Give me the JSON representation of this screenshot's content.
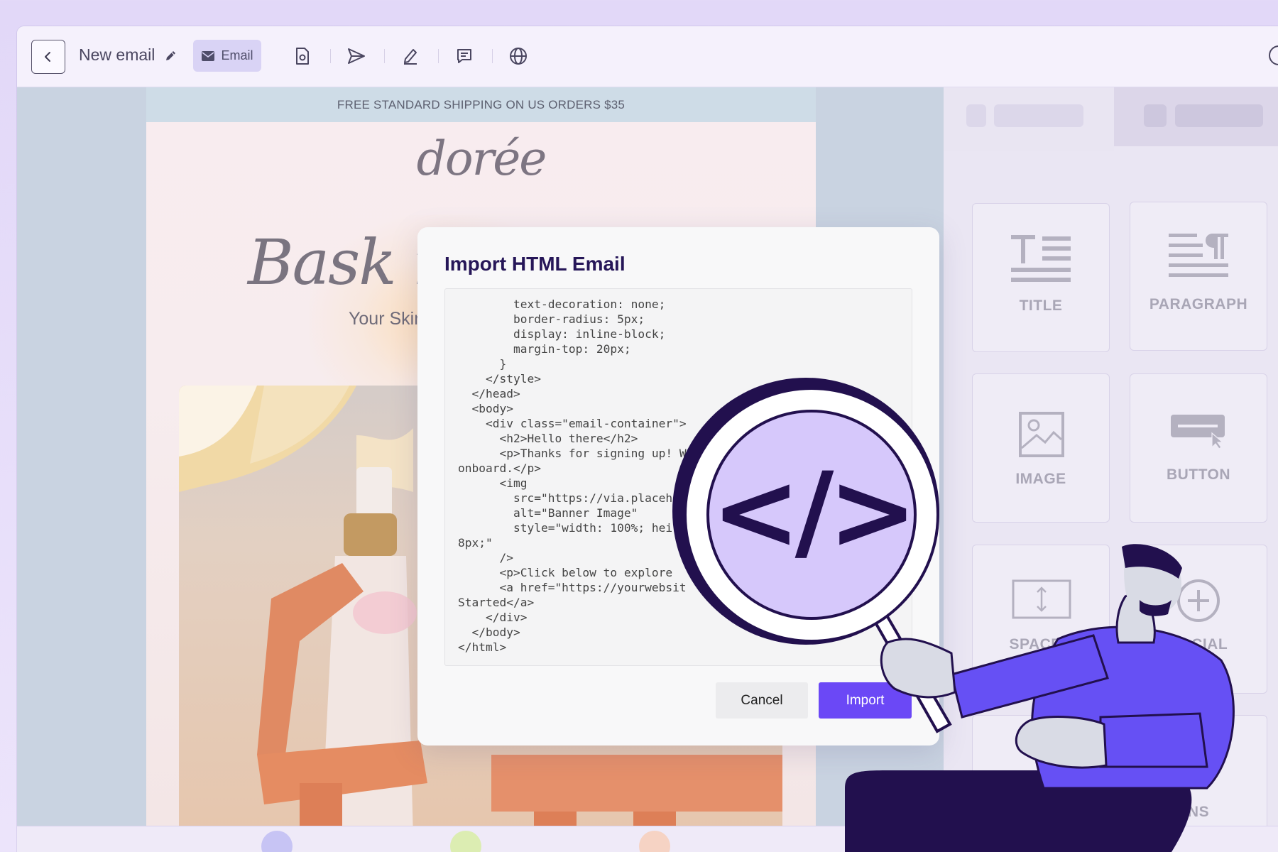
{
  "toolbar": {
    "title": "New email",
    "email_chip_label": "Email",
    "icons": [
      "back-icon",
      "pencil-icon",
      "email-icon",
      "document-icon",
      "send-icon",
      "pen-icon",
      "comment-icon",
      "globe-icon",
      "help-icon"
    ]
  },
  "email_preview": {
    "banner_text": "FREE STANDARD SHIPPING ON US ORDERS $35",
    "brand": "dorée",
    "headline": "Bask i",
    "subheadline": "Your Skin"
  },
  "sidebar": {
    "blocks": [
      {
        "label": "TITLE",
        "icon": "title-icon"
      },
      {
        "label": "PARAGRAPH",
        "icon": "paragraph-icon"
      },
      {
        "label": "IMAGE",
        "icon": "image-icon"
      },
      {
        "label": "BUTTON",
        "icon": "button-icon"
      },
      {
        "label": "SPACER",
        "icon": "spacer-icon"
      },
      {
        "label": "SOCIAL",
        "icon": "social-icon"
      },
      {
        "label": "NS",
        "icon": ""
      }
    ]
  },
  "dialog": {
    "title": "Import HTML Email",
    "code_lines": [
      "        text-decoration: none;",
      "        border-radius: 5px;",
      "        display: inline-block;",
      "        margin-top: 20px;",
      "      }",
      "    </style>",
      "  </head>",
      "  <body>",
      "    <div class=\"email-container\">",
      "      <h2>Hello there</h2>",
      "      <p>Thanks for signing up! We",
      "onboard.</p>",
      "      <img",
      "        src=\"https://via.placeh",
      "        alt=\"Banner Image\"",
      "        style=\"width: 100%; hei",
      "8px;\"",
      "      />",
      "      <p>Click below to explore",
      "      <a href=\"https://yourwebsit",
      "Started</a>",
      "    </div>",
      "  </body>",
      "</html>"
    ],
    "cancel_label": "Cancel",
    "import_label": "Import"
  },
  "illustration": {
    "magnifier_symbol": "</>",
    "colors": {
      "accent": "#6b48f6",
      "dark": "#22104e",
      "lens": "#d6c8fb"
    }
  },
  "colors": {
    "primary": "#6b48f6",
    "title_text": "#261658",
    "background": "#e2d8f8"
  }
}
